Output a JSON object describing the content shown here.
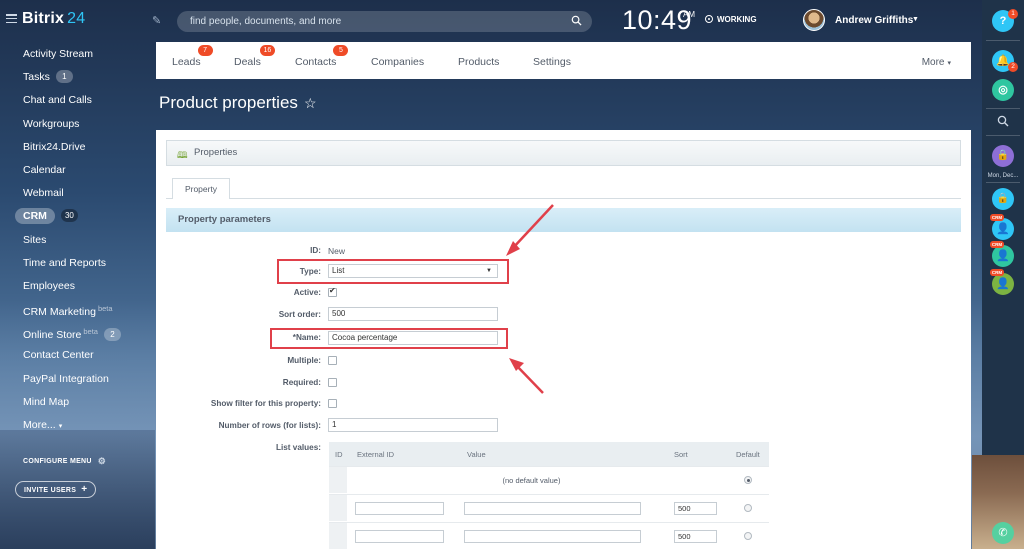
{
  "app": {
    "brand": "Bitrix",
    "brand_num": "24"
  },
  "topbar": {
    "search_placeholder": "find people, documents, and more",
    "time": "10:49",
    "ampm": "AM",
    "work_status": "WORKING",
    "user_name": "Andrew Griffiths"
  },
  "leftmenu": {
    "items": [
      {
        "label": "Activity Stream"
      },
      {
        "label": "Tasks",
        "counter": "1"
      },
      {
        "label": "Chat and Calls"
      },
      {
        "label": "Workgroups"
      },
      {
        "label": "Bitrix24.Drive"
      },
      {
        "label": "Calendar"
      },
      {
        "label": "Webmail"
      },
      {
        "label": "CRM",
        "counter": "30"
      },
      {
        "label": "Sites"
      },
      {
        "label": "Time and Reports"
      },
      {
        "label": "Employees"
      },
      {
        "label": "CRM Marketing",
        "tag": "beta"
      },
      {
        "label": "Online Store",
        "tag": "beta",
        "counter": "2"
      },
      {
        "label": "Contact Center"
      },
      {
        "label": "PayPal Integration"
      },
      {
        "label": "Mind Map"
      },
      {
        "label": "More..."
      }
    ],
    "configure": "CONFIGURE MENU",
    "invite": "INVITE USERS"
  },
  "crm_tabs": [
    {
      "label": "Leads",
      "badge": "7"
    },
    {
      "label": "Deals",
      "badge": "16"
    },
    {
      "label": "Contacts",
      "badge": "5"
    },
    {
      "label": "Companies"
    },
    {
      "label": "Products"
    },
    {
      "label": "Settings"
    }
  ],
  "crm_more": "More",
  "page_title": "Product properties",
  "properties_header": "Properties",
  "property_tab": "Property",
  "params_title": "Property parameters",
  "form": {
    "id_label": "ID:",
    "id_value": "New",
    "type_label": "Type:",
    "type_value": "List",
    "active_label": "Active:",
    "active_checked": true,
    "sort_label": "Sort order:",
    "sort_value": "500",
    "name_label": "*Name:",
    "name_value": "Cocoa percentage",
    "multiple_label": "Multiple:",
    "required_label": "Required:",
    "filter_label": "Show filter for this property:",
    "rows_label": "Number of rows (for lists):",
    "rows_value": "1",
    "list_values_label": "List values:"
  },
  "list_values": {
    "columns": [
      "ID",
      "External ID",
      "Value",
      "Sort",
      "Default"
    ],
    "no_default": "(no default value)",
    "rows": [
      {
        "sort": "500"
      },
      {
        "sort": "500"
      }
    ]
  },
  "rightbar": {
    "help_badge": "1",
    "notify_badge": "2",
    "date_label": "Mon, Dec...",
    "crm_tag": "CRM"
  },
  "colors": {
    "accent_red": "#e0404a",
    "badge_red": "#ef4b27",
    "brand_blue": "#2fc6f6",
    "params_bar": "#c3e2f1"
  }
}
